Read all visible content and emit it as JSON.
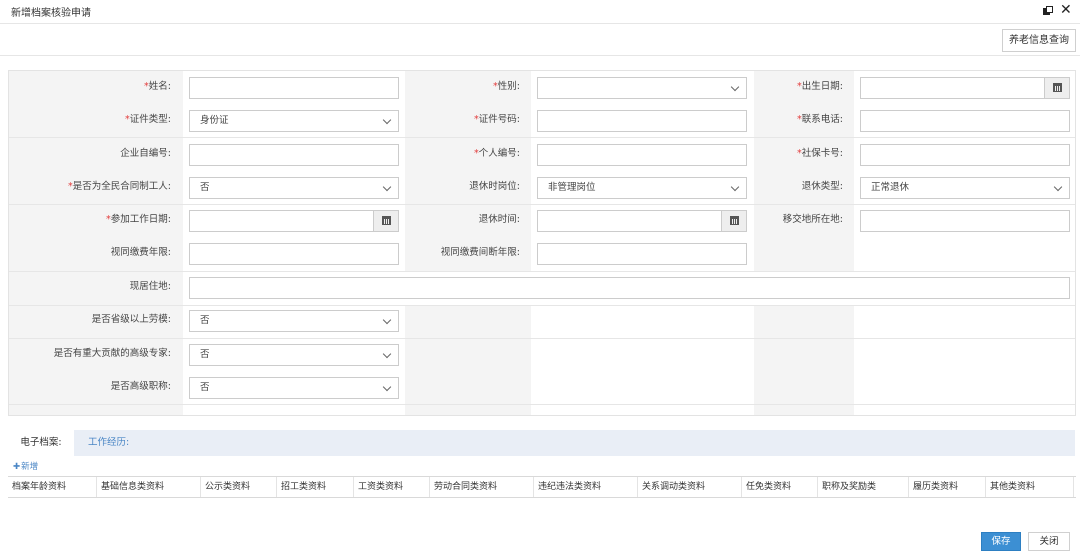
{
  "window": {
    "title": "新增档案核验申请",
    "restore_icon": "restore-window-icon",
    "close_icon": "close-icon",
    "close_glyph": "✕"
  },
  "toolbar": {
    "pension_query_label": "养老信息查询"
  },
  "form": {
    "required_mark": "*",
    "name": {
      "label": "姓名:",
      "value": ""
    },
    "gender": {
      "label": "性别:",
      "value": ""
    },
    "birth_date": {
      "label": "出生日期:",
      "value": ""
    },
    "id_type": {
      "label": "证件类型:",
      "value": "身份证"
    },
    "id_number": {
      "label": "证件号码:",
      "value": ""
    },
    "phone": {
      "label": "联系电话:",
      "value": ""
    },
    "company_code": {
      "label": "企业自编号:",
      "value": ""
    },
    "personal_code": {
      "label": "个人编号:",
      "value": ""
    },
    "social_card": {
      "label": "社保卡号:",
      "value": ""
    },
    "contract_worker": {
      "label": "是否为全民合同制工人:",
      "value": "否"
    },
    "retire_position": {
      "label": "退休时岗位:",
      "value": "非管理岗位"
    },
    "retire_type": {
      "label": "退休类型:",
      "value": "正常退休"
    },
    "work_start_date": {
      "label": "参加工作日期:",
      "value": ""
    },
    "retire_time": {
      "label": "退休时间:",
      "value": ""
    },
    "transfer_location": {
      "label": "移交地所在地:",
      "value": ""
    },
    "deemed_years": {
      "label": "视同缴费年限:",
      "value": ""
    },
    "deemed_gap": {
      "label": "视同缴费间断年限:",
      "value": ""
    },
    "residence": {
      "label": "现居住地:",
      "value": ""
    },
    "provincial_model": {
      "label": "是否省级以上劳模:",
      "value": "否"
    },
    "senior_expert": {
      "label": "是否有重大贡献的高级专家:",
      "value": "否"
    },
    "senior_title": {
      "label": "是否高级职称:",
      "value": "否"
    }
  },
  "tabs": [
    {
      "label": "电子档案:"
    },
    {
      "label": "工作经历:"
    }
  ],
  "add_link": {
    "icon": "plus-icon",
    "glyph": "✚",
    "label": "新增"
  },
  "doc_columns": [
    "档案年龄资料",
    "基础信息类资料",
    "公示类资料",
    "招工类资料",
    "工资类资料",
    "劳动合同类资料",
    "违纪违法类资料",
    "关系调动类资料",
    "任免类资料",
    "职称及奖励类",
    "履历类资料",
    "其他类资料"
  ],
  "footer": {
    "save_label": "保存",
    "close_label": "关闭"
  },
  "colors": {
    "accent": "#3c8fd3",
    "required": "#e23b3b",
    "tab_link": "#4a86c5",
    "label_bg": "#f4f4f4"
  }
}
